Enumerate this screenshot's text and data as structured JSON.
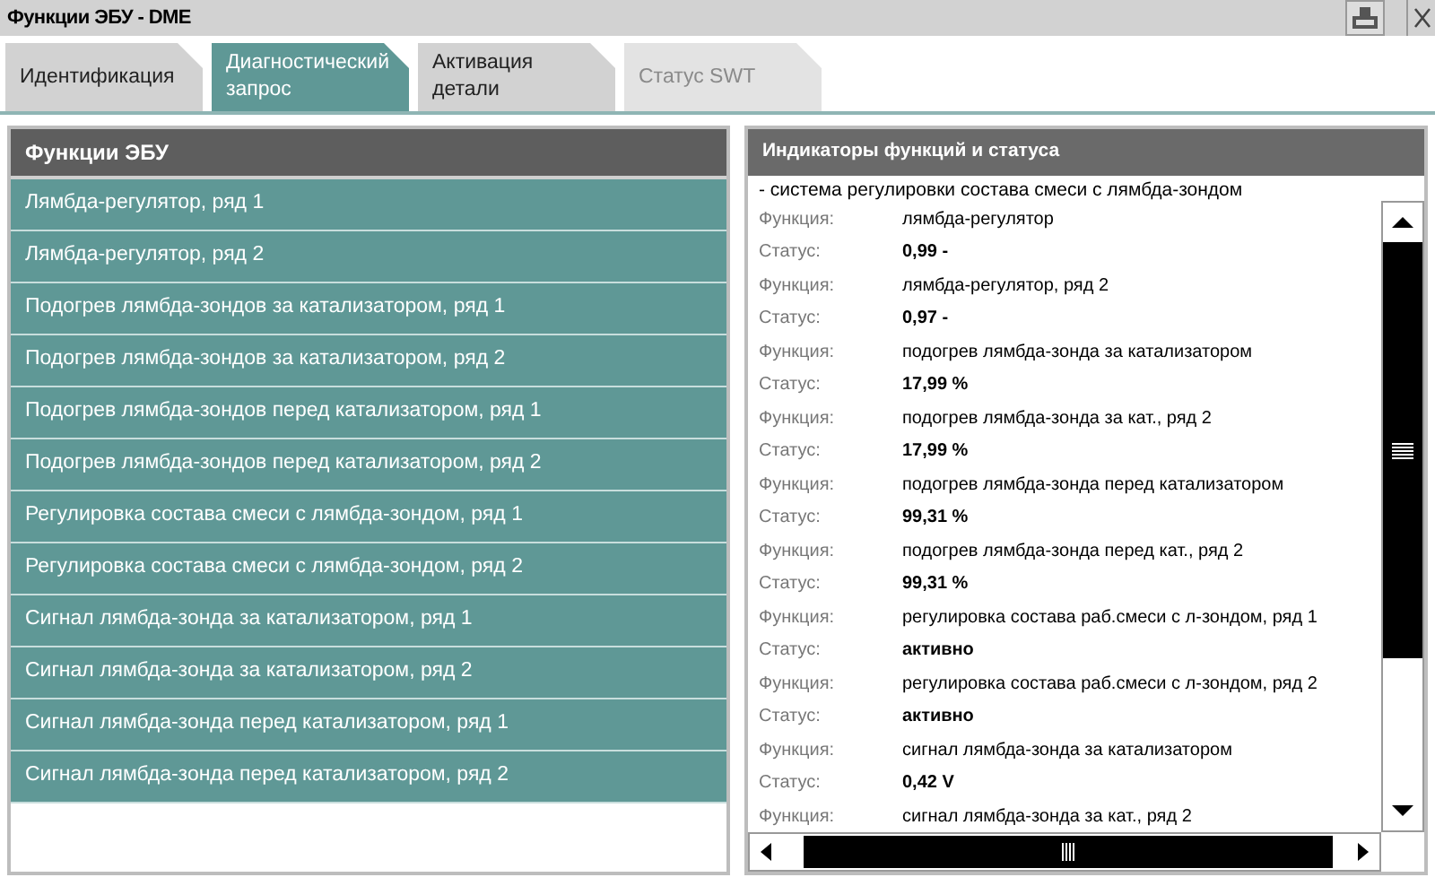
{
  "window": {
    "title": "Функции ЭБУ - DME"
  },
  "tabs": [
    {
      "label": "Идентификация",
      "selected": false,
      "disabled": false
    },
    {
      "label": "Диагностический запрос",
      "selected": true,
      "disabled": false
    },
    {
      "label": "Активация детали",
      "selected": false,
      "disabled": false
    },
    {
      "label": "Статус SWT",
      "selected": false,
      "disabled": true
    }
  ],
  "functions_panel": {
    "title": "Функции ЭБУ",
    "items": [
      "Лямбда-регулятор, ряд 1",
      "Лямбда-регулятор, ряд 2",
      "Подогрев лямбда-зондов за катализатором, ряд 1",
      "Подогрев лямбда-зондов за катализатором, ряд 2",
      "Подогрев лямбда-зондов перед катализатором, ряд 1",
      "Подогрев лямбда-зондов перед катализатором, ряд 2",
      "Регулировка состава смеси с лямбда-зондом, ряд 1",
      "Регулировка состава смеси с лямбда-зондом, ряд 2",
      "Сигнал лямбда-зонда за катализатором, ряд 1",
      "Сигнал лямбда-зонда за катализатором, ряд 2",
      "Сигнал лямбда-зонда перед катализатором, ряд 1",
      "Сигнал лямбда-зонда перед катализатором, ряд 2"
    ]
  },
  "status_panel": {
    "title": "Индикаторы функций и статуса",
    "group": "- система регулировки состава смеси с лямбда-зондом",
    "entries": [
      {
        "function_label": "Функция:",
        "function": "лямбда-регулятор",
        "status_label": "Статус:",
        "status": "0,99 -"
      },
      {
        "function_label": "Функция:",
        "function": "лямбда-регулятор, ряд 2",
        "status_label": "Статус:",
        "status": "0,97 -"
      },
      {
        "function_label": "Функция:",
        "function": "подогрев лямбда-зонда за катализатором",
        "status_label": "Статус:",
        "status": "17,99 %"
      },
      {
        "function_label": "Функция:",
        "function": "подогрев лямбда-зонда за кат., ряд 2",
        "status_label": "Статус:",
        "status": "17,99 %"
      },
      {
        "function_label": "Функция:",
        "function": "подогрев лямбда-зонда перед катализатором",
        "status_label": "Статус:",
        "status": "99,31 %"
      },
      {
        "function_label": "Функция:",
        "function": "подогрев лямбда-зонда перед кат., ряд 2",
        "status_label": "Статус:",
        "status": "99,31 %"
      },
      {
        "function_label": "Функция:",
        "function": "регулировка состава раб.смеси с л-зондом, ряд 1",
        "status_label": "Статус:",
        "status": "активно"
      },
      {
        "function_label": "Функция:",
        "function": "регулировка состава раб.смеси с л-зондом, ряд 2",
        "status_label": "Статус:",
        "status": "активно"
      },
      {
        "function_label": "Функция:",
        "function": "сигнал лямбда-зонда за катализатором",
        "status_label": "Статус:",
        "status": "0,42 V"
      },
      {
        "function_label": "Функция:",
        "function": "сигнал лямбда-зонда за кат., ряд 2"
      }
    ]
  }
}
